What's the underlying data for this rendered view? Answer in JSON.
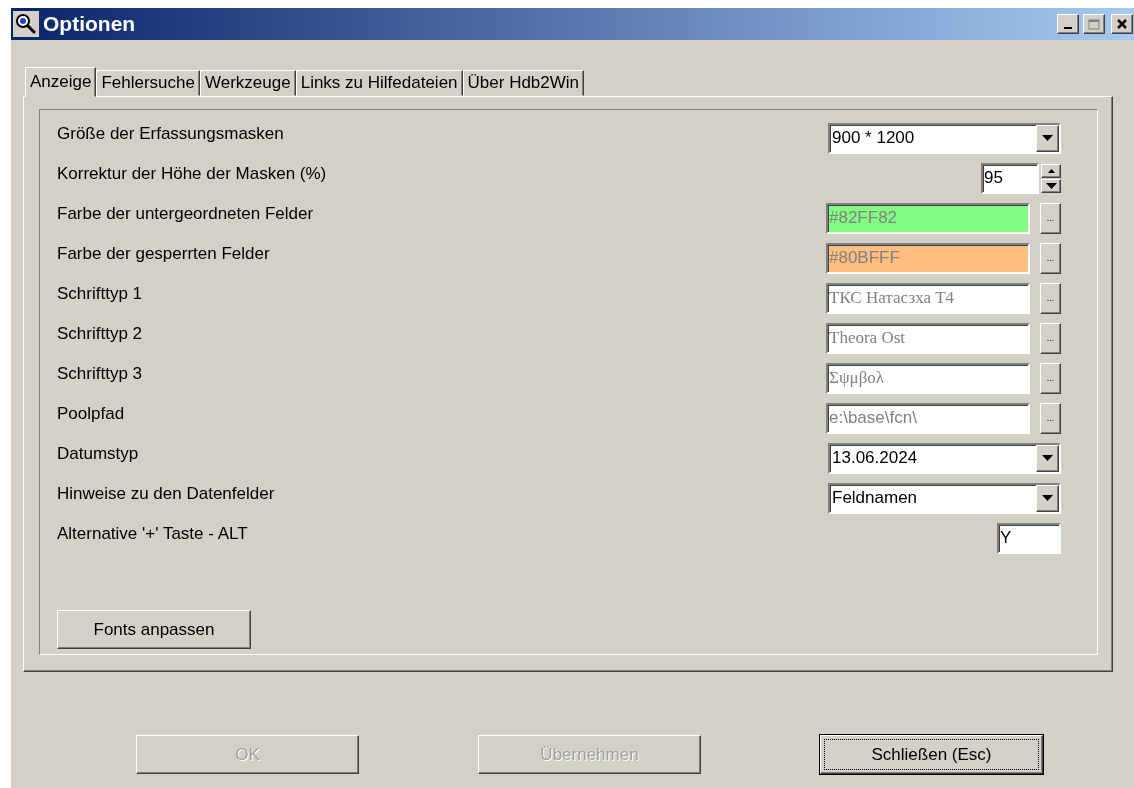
{
  "window": {
    "title": "Optionen"
  },
  "tabs": [
    {
      "label": "Anzeige",
      "selected": true
    },
    {
      "label": "Fehlersuche",
      "selected": false
    },
    {
      "label": "Werkzeuge",
      "selected": false
    },
    {
      "label": "Links zu Hilfedateien",
      "selected": false
    },
    {
      "label": "Über Hdb2Win",
      "selected": false
    }
  ],
  "settings": [
    {
      "kind": "dropdown",
      "label": "Größe der Erfassungsmasken",
      "value": "900 * 1200"
    },
    {
      "kind": "spinner",
      "label": "Korrektur der Höhe der Masken (%)",
      "value": "95"
    },
    {
      "kind": "picker",
      "label": "Farbe der untergeordneten Felder",
      "value": "#82FF82",
      "color": "#82ff82",
      "button": "..."
    },
    {
      "kind": "picker",
      "label": "Farbe der gesperrten Felder",
      "value": "#80BFFF",
      "color": "#ffbf80",
      "button": "..."
    },
    {
      "kind": "font",
      "label": "Schrifttyp 1",
      "value": "ТКС Натасзха Т4",
      "button": "..."
    },
    {
      "kind": "font",
      "label": "Schrifttyp 2",
      "value": "Theora Ost",
      "button": "..."
    },
    {
      "kind": "font",
      "label": "Schrifttyp 3",
      "value": "Σψμβολ",
      "button": "..."
    },
    {
      "kind": "picker",
      "label": "Poolpfad",
      "value": "e:\\base\\fcn\\",
      "button": "..."
    },
    {
      "kind": "dropdown",
      "label": "Datumstyp",
      "value": "13.06.2024"
    },
    {
      "kind": "dropdown",
      "label": "Hinweise zu den Datenfelder",
      "value": "Feldnamen"
    },
    {
      "kind": "short",
      "label": "Alternative '+' Taste - ALT",
      "value": "Y"
    }
  ],
  "fonts_button": "Fonts anpassen",
  "buttons": [
    {
      "label": "OK",
      "disabled": true,
      "default": false
    },
    {
      "label": "Übernehmen",
      "disabled": true,
      "default": false
    },
    {
      "label": "Schließen (Esc)",
      "disabled": false,
      "default": true
    }
  ]
}
